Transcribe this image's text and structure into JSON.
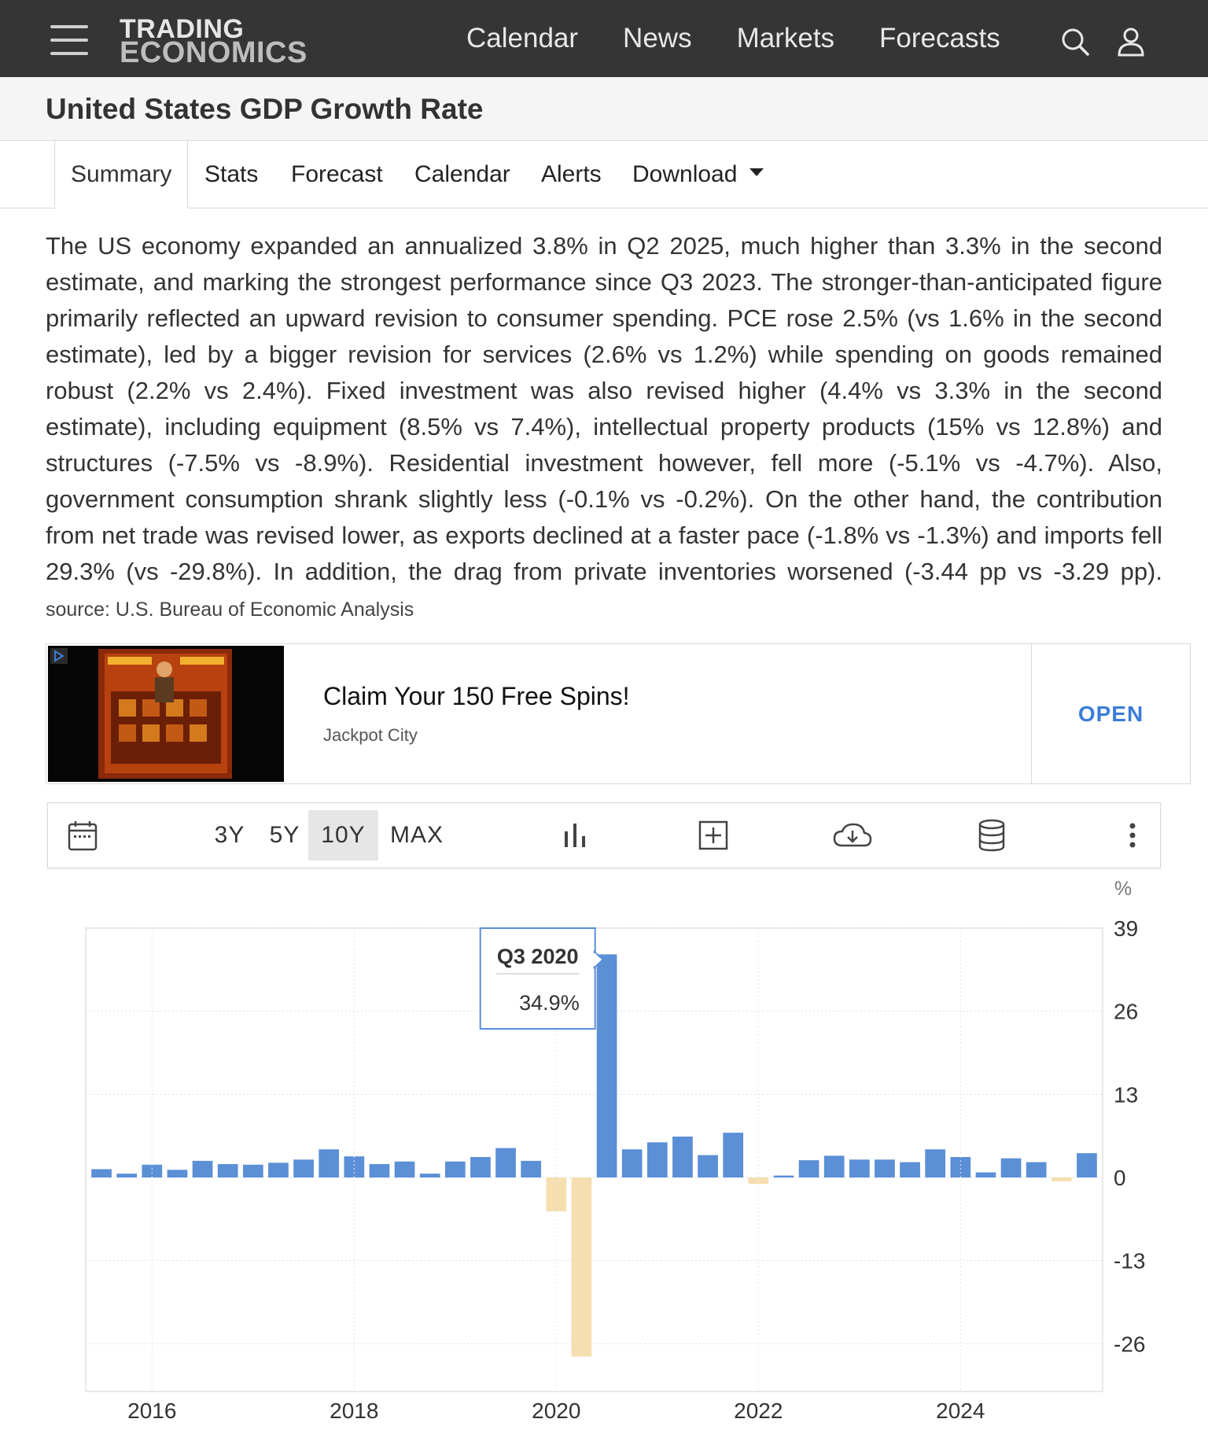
{
  "logo": {
    "line1": "TRADING",
    "line2": "ECONOMICS"
  },
  "nav": {
    "items": [
      "Calendar",
      "News",
      "Markets",
      "Forecasts"
    ],
    "search_icon": "search-icon",
    "user_icon": "user-icon"
  },
  "page_title": "United States GDP Growth Rate",
  "tabs": {
    "summary": "Summary",
    "stats": "Stats",
    "forecast": "Forecast",
    "calendar": "Calendar",
    "alerts": "Alerts",
    "download": "Download"
  },
  "summary": {
    "text": "The US economy expanded an annualized 3.8% in Q2 2025, much higher than 3.3% in the second estimate, and marking the strongest performance since Q3 2023. The stronger-than-anticipated figure primarily reflected an upward revision to consumer spending. PCE rose 2.5% (vs 1.6% in the second estimate), led by a bigger revision for services (2.6% vs 1.2%) while spending on goods remained robust (2.2% vs 2.4%). Fixed investment was also revised higher (4.4% vs 3.3% in the second estimate), including equipment (8.5% vs 7.4%), intellectual property products (15% vs 12.8%) and structures (-7.5% vs -8.9%). Residential investment however, fell more (-5.1% vs -4.7%). Also, government consumption shrank slightly less (-0.1% vs -0.2%). On the other hand, the contribution from net trade was revised lower, as exports declined at a faster pace (-1.8% vs -1.3%) and imports fell 29.3% (vs -29.8%). In addition, the drag from private inventories worsened (-3.44 pp vs -3.29 pp).",
    "source": "source: U.S. Bureau of Economic Analysis"
  },
  "ad": {
    "title": "Claim Your 150 Free Spins!",
    "advertiser": "Jackpot City",
    "cta": "OPEN",
    "adchoices_icon": "adchoices-icon"
  },
  "toolbar": {
    "ranges": [
      "3Y",
      "5Y",
      "10Y",
      "MAX"
    ],
    "active_range": "10Y",
    "icons": [
      "calendar-icon",
      "bar-chart-icon",
      "add-icon",
      "download-cloud-icon",
      "database-icon",
      "more-icon"
    ]
  },
  "colors": {
    "positive": "#5b8fd6",
    "negative": "#f5deb0",
    "topbar": "#353535",
    "accent": "#3b7dd8"
  },
  "chart_data": {
    "type": "bar",
    "unit": "%",
    "ylim": [
      -33,
      39
    ],
    "yticks": [
      39,
      26,
      13,
      0,
      -13,
      -26
    ],
    "xticks": [
      "2016",
      "2018",
      "2020",
      "2022",
      "2024"
    ],
    "grid": true,
    "categories": [
      "Q3 2015",
      "Q4 2015",
      "Q1 2016",
      "Q2 2016",
      "Q3 2016",
      "Q4 2016",
      "Q1 2017",
      "Q2 2017",
      "Q3 2017",
      "Q4 2017",
      "Q1 2018",
      "Q2 2018",
      "Q3 2018",
      "Q4 2018",
      "Q1 2019",
      "Q2 2019",
      "Q3 2019",
      "Q4 2019",
      "Q1 2020",
      "Q2 2020",
      "Q3 2020",
      "Q4 2020",
      "Q1 2021",
      "Q2 2021",
      "Q3 2021",
      "Q4 2021",
      "Q1 2022",
      "Q2 2022",
      "Q3 2022",
      "Q4 2022",
      "Q1 2023",
      "Q2 2023",
      "Q3 2023",
      "Q4 2023",
      "Q1 2024",
      "Q2 2024",
      "Q3 2024",
      "Q4 2024",
      "Q1 2025",
      "Q2 2025"
    ],
    "values": [
      1.3,
      0.6,
      2.0,
      1.2,
      2.6,
      2.1,
      2.0,
      2.3,
      2.8,
      4.4,
      3.3,
      2.1,
      2.5,
      0.6,
      2.5,
      3.2,
      4.6,
      2.6,
      -5.3,
      -28.0,
      34.9,
      4.4,
      5.5,
      6.4,
      3.5,
      7.0,
      -1.0,
      0.3,
      2.7,
      3.4,
      2.8,
      2.8,
      2.4,
      4.4,
      3.2,
      0.8,
      3.0,
      2.4,
      -0.6,
      3.8
    ],
    "tooltip": {
      "label": "Q3 2020",
      "value": "34.9%"
    }
  }
}
